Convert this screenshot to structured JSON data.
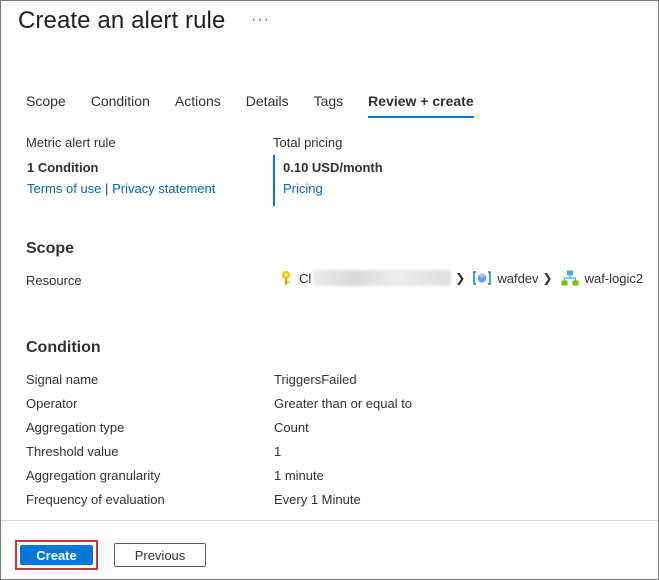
{
  "header": {
    "title": "Create an alert rule",
    "more_label": "···"
  },
  "tabs": [
    {
      "label": "Scope",
      "active": false
    },
    {
      "label": "Condition",
      "active": false
    },
    {
      "label": "Actions",
      "active": false
    },
    {
      "label": "Details",
      "active": false
    },
    {
      "label": "Tags",
      "active": false
    },
    {
      "label": "Review + create",
      "active": true
    }
  ],
  "summary": {
    "rule_type": "Metric alert rule",
    "condition_count": "1 Condition",
    "terms_link": "Terms of use",
    "separator": "|",
    "privacy_link": "Privacy statement",
    "pricing_label": "Total pricing",
    "pricing_value": "0.10 USD/month",
    "pricing_link": "Pricing"
  },
  "scope": {
    "title": "Scope",
    "resource_label": "Resource",
    "breadcrumb": {
      "subscription_prefix": "Cl",
      "resource_group": "wafdev",
      "resource": "waf-logic2"
    }
  },
  "condition": {
    "title": "Condition",
    "rows": [
      {
        "label": "Signal name",
        "value": "TriggersFailed"
      },
      {
        "label": "Operator",
        "value": "Greater than or equal to"
      },
      {
        "label": "Aggregation type",
        "value": "Count"
      },
      {
        "label": "Threshold value",
        "value": "1"
      },
      {
        "label": "Aggregation granularity",
        "value": "1 minute"
      },
      {
        "label": "Frequency of evaluation",
        "value": "Every 1 Minute"
      }
    ]
  },
  "footer": {
    "create_label": "Create",
    "previous_label": "Previous"
  },
  "colors": {
    "accent": "#0078d4",
    "link": "#0067b8",
    "highlight_border": "#d13438"
  },
  "icons": {
    "subscription": "key-icon",
    "resource_group": "resource-group-icon",
    "resource": "logic-app-icon",
    "separator": "chevron-right-icon"
  }
}
